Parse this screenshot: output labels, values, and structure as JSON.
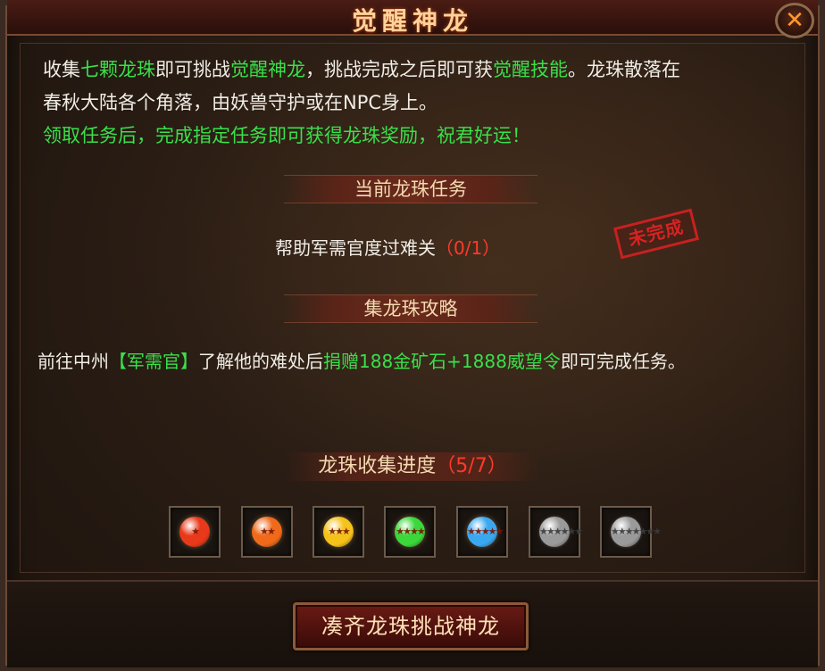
{
  "window": {
    "title": "觉醒神龙",
    "close_icon": "✕"
  },
  "intro": {
    "l1_a": "收集",
    "l1_b": "七颗龙珠",
    "l1_c": "即可挑战",
    "l1_d": "觉醒神龙",
    "l1_e": "，挑战完成之后即可获",
    "l1_f": "觉醒技能",
    "l1_g": "。龙珠散落在",
    "l2": "春秋大陆各个角落，由妖兽守护或在NPC身上。",
    "l3": "领取任务后，完成指定任务即可获得龙珠奖励，祝君好运！"
  },
  "current_task": {
    "header": "当前龙珠任务",
    "task_name": "帮助军需官度过难关",
    "progress": "（0/1）",
    "status_stamp": "未完成"
  },
  "guide": {
    "header": "集龙珠攻略",
    "a": "前往中州",
    "b": "【军需官】",
    "c": "了解他的难处后",
    "d": "捐赠188金矿石+1888威望令",
    "e": "即可完成任务。"
  },
  "collection": {
    "label": "龙珠收集进度",
    "progress": "（5/7）",
    "collected": 5,
    "total": 7,
    "orbs": [
      {
        "name": "red",
        "color": "#e83a1a",
        "stars": "★",
        "collected": true
      },
      {
        "name": "orange",
        "color": "#f06a1a",
        "stars": "★★",
        "collected": true
      },
      {
        "name": "yellow",
        "color": "#f5c21a",
        "stars": "★★★",
        "collected": true
      },
      {
        "name": "green",
        "color": "#3ad83a",
        "stars": "★★★★",
        "collected": true
      },
      {
        "name": "blue",
        "color": "#3aa8f0",
        "stars": "★★★★★",
        "collected": true
      },
      {
        "name": "gray",
        "color": "#9a9a9a",
        "stars": "★★★★★★",
        "collected": false
      },
      {
        "name": "gray",
        "color": "#9a9a9a",
        "stars": "★★★★★★★",
        "collected": false
      }
    ]
  },
  "action": {
    "button_label": "凑齐龙珠挑战神龙"
  }
}
